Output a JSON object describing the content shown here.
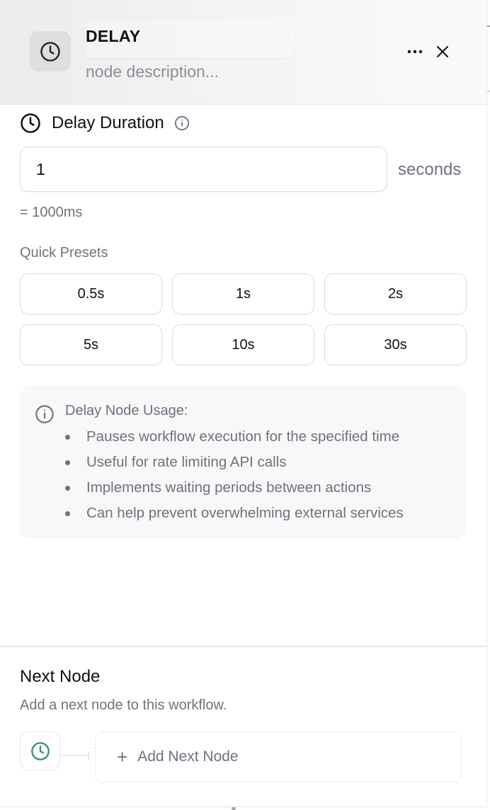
{
  "header": {
    "title": "DELAY",
    "description_placeholder": "node description...",
    "node_icon": "clock-icon",
    "more_icon": "more-horizontal-icon",
    "close_icon": "close-icon"
  },
  "delay_duration": {
    "label": "Delay Duration",
    "value": "1",
    "unit": "seconds",
    "ms_text": "= 1000ms"
  },
  "presets": {
    "label": "Quick Presets",
    "items": [
      "0.5s",
      "1s",
      "2s",
      "5s",
      "10s",
      "30s"
    ]
  },
  "usage": {
    "title": "Delay Node Usage:",
    "items": [
      "Pauses workflow execution for the specified time",
      "Useful for rate limiting API calls",
      "Implements waiting periods between actions",
      "Can help prevent overwhelming external services"
    ]
  },
  "next_node": {
    "title": "Next Node",
    "subtitle": "Add a next node to this workflow.",
    "add_label": "Add Next Node",
    "accent_color": "#3f8f6e"
  }
}
